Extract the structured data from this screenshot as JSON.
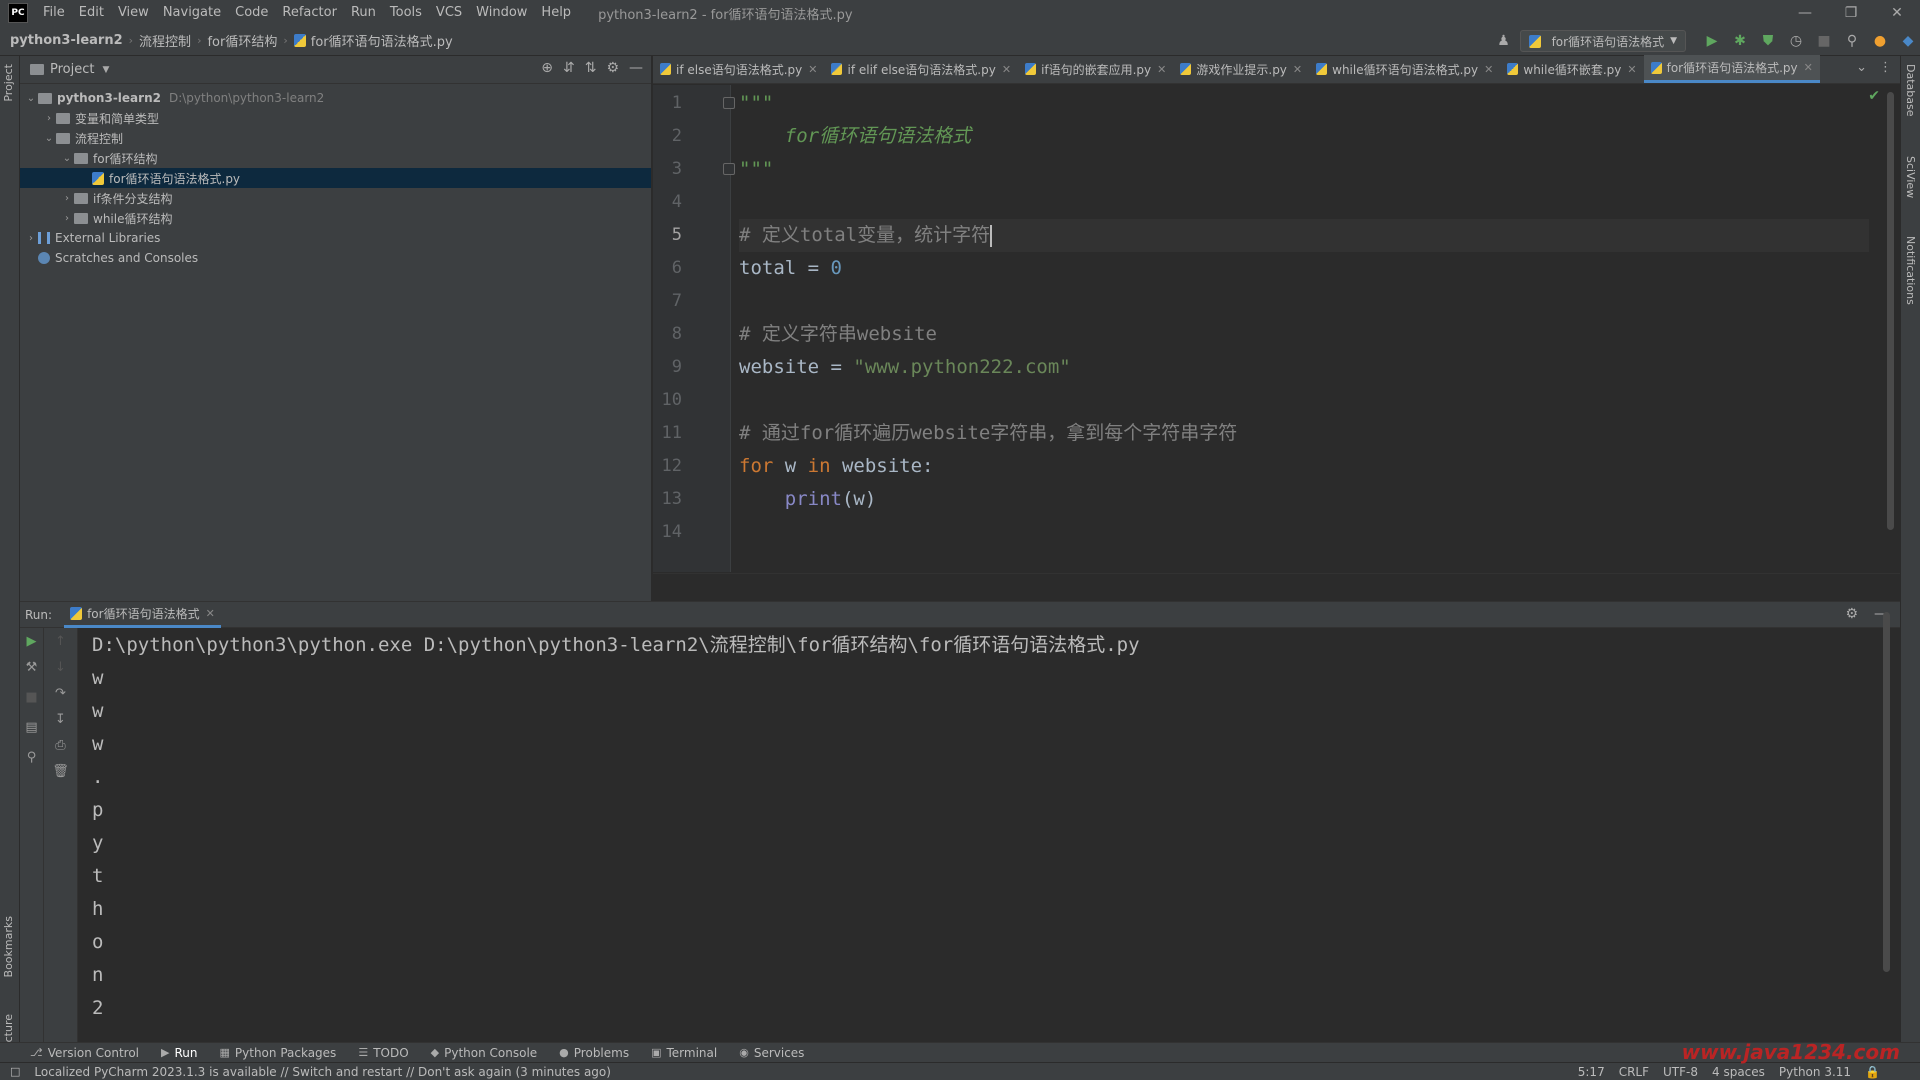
{
  "app": {
    "logo": "PC",
    "window_title": "python3-learn2 - for循环语句语法格式.py",
    "menu": [
      "File",
      "Edit",
      "View",
      "Navigate",
      "Code",
      "Refactor",
      "Run",
      "Tools",
      "VCS",
      "Window",
      "Help"
    ]
  },
  "breadcrumbs": [
    "python3-learn2",
    "流程控制",
    "for循环结构",
    "for循环语句语法格式.py"
  ],
  "run_config": "for循环语句语法格式",
  "project": {
    "title": "Project",
    "tree": [
      {
        "label": "python3-learn2",
        "hint": "D:\\python\\python3-learn2",
        "type": "folder",
        "level": 0,
        "expanded": true,
        "bold": true
      },
      {
        "label": "变量和简单类型",
        "type": "folder",
        "level": 1,
        "expanded": false
      },
      {
        "label": "流程控制",
        "type": "folder",
        "level": 1,
        "expanded": true
      },
      {
        "label": "for循环结构",
        "type": "folder",
        "level": 2,
        "expanded": true
      },
      {
        "label": "for循环语句语法格式.py",
        "type": "py",
        "level": 3,
        "selected": true
      },
      {
        "label": "if条件分支结构",
        "type": "folder",
        "level": 2,
        "expanded": false
      },
      {
        "label": "while循环结构",
        "type": "folder",
        "level": 2,
        "expanded": false
      },
      {
        "label": "External Libraries",
        "type": "lib",
        "level": 0,
        "expanded": false
      },
      {
        "label": "Scratches and Consoles",
        "type": "scratch",
        "level": 0
      }
    ]
  },
  "tabs": [
    {
      "label": "if else语句语法格式.py",
      "active": false
    },
    {
      "label": "if elif else语句语法格式.py",
      "active": false
    },
    {
      "label": "if语句的嵌套应用.py",
      "active": false
    },
    {
      "label": "游戏作业提示.py",
      "active": false
    },
    {
      "label": "while循环语句语法格式.py",
      "active": false
    },
    {
      "label": "while循环嵌套.py",
      "active": false
    },
    {
      "label": "for循环语句语法格式.py",
      "active": true
    }
  ],
  "code": {
    "current_line": 5,
    "lines": [
      [
        {
          "t": "\"\"\"",
          "c": "c-doc"
        }
      ],
      [
        {
          "t": "    for循环语句语法格式",
          "c": "c-doc"
        }
      ],
      [
        {
          "t": "\"\"\"",
          "c": "c-doc"
        }
      ],
      [],
      [
        {
          "t": "# 定义total变量，统计字符",
          "c": "c-comment"
        }
      ],
      [
        {
          "t": "total = ",
          "c": ""
        },
        {
          "t": "0",
          "c": "c-num"
        }
      ],
      [],
      [
        {
          "t": "# 定义字符串website",
          "c": "c-comment"
        }
      ],
      [
        {
          "t": "website = ",
          "c": ""
        },
        {
          "t": "\"www.python222.com\"",
          "c": "c-str"
        }
      ],
      [],
      [
        {
          "t": "# 通过for循环遍历website字符串，拿到每个字符串字符",
          "c": "c-comment"
        }
      ],
      [
        {
          "t": "for",
          "c": "c-kw"
        },
        {
          "t": " w ",
          "c": ""
        },
        {
          "t": "in",
          "c": "c-kw"
        },
        {
          "t": " website:",
          "c": ""
        }
      ],
      [
        {
          "t": "    ",
          "c": ""
        },
        {
          "t": "print",
          "c": "c-builtin"
        },
        {
          "t": "(w)",
          "c": ""
        }
      ],
      []
    ]
  },
  "run": {
    "label": "Run:",
    "tab": "for循环语句语法格式",
    "output": [
      "D:\\python\\python3\\python.exe D:\\python\\python3-learn2\\流程控制\\for循环结构\\for循环语句语法格式.py",
      "w",
      "w",
      "w",
      ".",
      "p",
      "y",
      "t",
      "h",
      "o",
      "n",
      "2"
    ]
  },
  "bottom_tools": [
    "Version Control",
    "Run",
    "Python Packages",
    "TODO",
    "Python Console",
    "Problems",
    "Terminal",
    "Services"
  ],
  "left_stripe": {
    "top": "Project",
    "bottom1": "Bookmarks",
    "bottom2": "Structure"
  },
  "right_stripe": [
    "Database",
    "SciView",
    "Notifications"
  ],
  "status": {
    "message": "Localized PyCharm 2023.1.3 is available // Switch and restart // Don't ask again (3 minutes ago)",
    "position": "5:17",
    "line_sep": "CRLF",
    "encoding": "UTF-8",
    "indent": "4 spaces",
    "interpreter": "Python 3.11"
  },
  "watermark": "www.java1234.com"
}
